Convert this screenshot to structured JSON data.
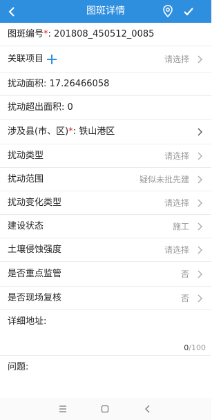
{
  "header": {
    "title": "图斑详情",
    "back_icon": "back-arrow-icon",
    "location_icon": "location-pin-icon",
    "confirm_icon": "check-icon"
  },
  "fields": {
    "id": {
      "label": "图斑编号",
      "required_mark": "*",
      "sep": ":",
      "value": "201808_450512_0085"
    },
    "project": {
      "label": "关联项目",
      "placeholder": "请选择"
    },
    "area": {
      "label": "扰动面积:",
      "value": "17.26466058"
    },
    "excess_area": {
      "label": "扰动超出面积:",
      "value": "0"
    },
    "county": {
      "label": "涉及县(市、区)",
      "required_mark": "*",
      "sep": ":",
      "value": "铁山港区"
    },
    "disturb_type": {
      "label": "扰动类型",
      "value": "请选择"
    },
    "disturb_range": {
      "label": "扰动范围",
      "value": "疑似未批先建"
    },
    "change_type": {
      "label": "扰动变化类型",
      "value": "请选择"
    },
    "build_status": {
      "label": "建设状态",
      "value": "施工"
    },
    "erosion": {
      "label": "土壤侵蚀强度",
      "value": "请选择"
    },
    "key_supervision": {
      "label": "是否重点监管",
      "value": "否"
    },
    "review": {
      "label": "是否现场复核",
      "value": "否"
    },
    "address": {
      "label": "详细地址:",
      "count": "0",
      "max": "/100"
    },
    "issue": {
      "label": "问题:"
    }
  },
  "navbar": {
    "icons": [
      "menu-icon",
      "home-square-icon",
      "back-triangle-icon"
    ]
  },
  "colors": {
    "header_bg": "#2f8fdf",
    "required": "#e02020",
    "accent": "#2f8fdf"
  }
}
